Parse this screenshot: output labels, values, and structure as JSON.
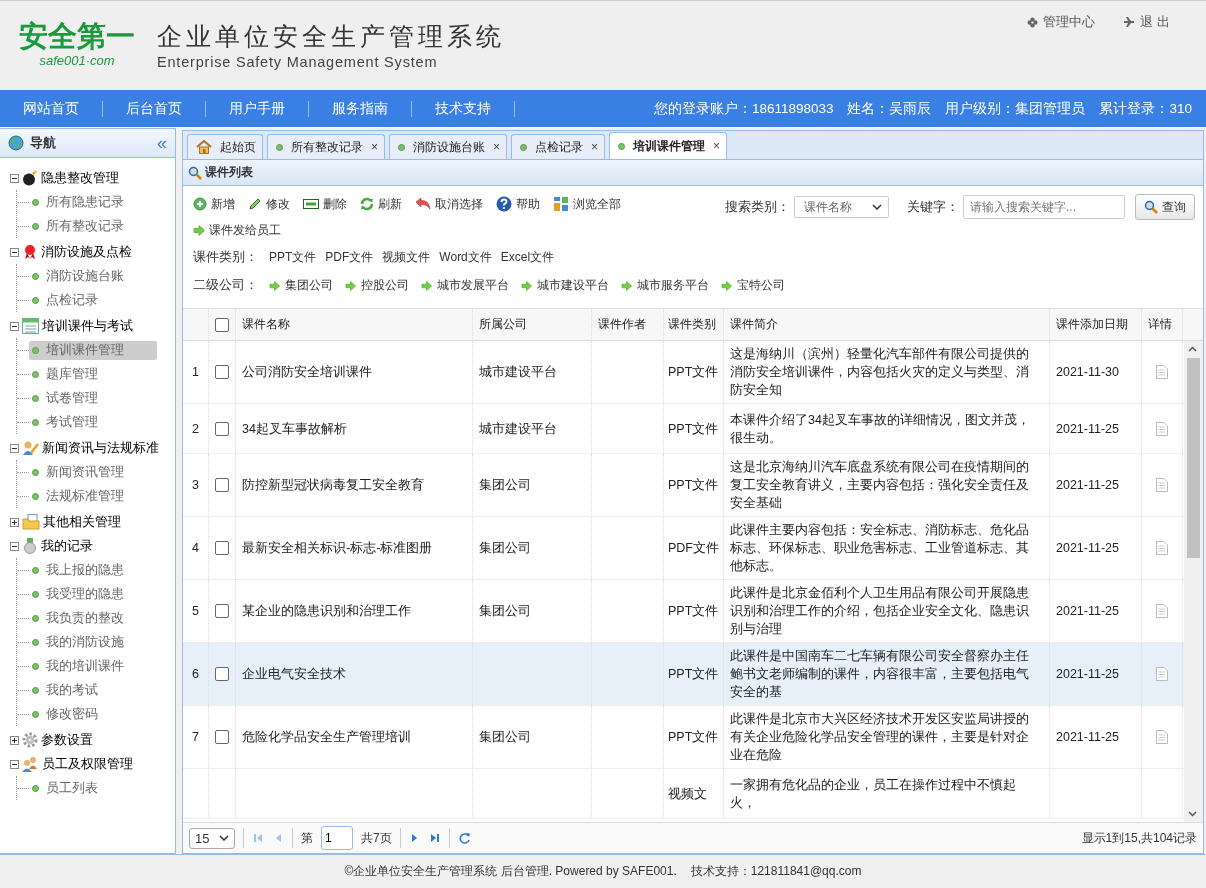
{
  "header": {
    "logo_text": "安全第一",
    "logo_url": "safe001·com",
    "title": "企业单位安全生产管理系统",
    "subtitle": "Enterprise Safety Management System",
    "links": [
      "管理中心",
      "退 出"
    ]
  },
  "nav": {
    "items": [
      "网站首页",
      "后台首页",
      "用户手册",
      "服务指南",
      "技术支持"
    ],
    "user_info": [
      "您的登录账户：18611898033",
      "姓名：吴雨辰",
      "用户级别：集团管理员",
      "累计登录：310"
    ]
  },
  "sidebar": {
    "title": "导航",
    "collapse": "«",
    "groups": [
      {
        "label": "隐患整改管理",
        "expanded": true,
        "children": [
          {
            "label": "所有隐患记录",
            "selected": false
          },
          {
            "label": "所有整改记录",
            "selected": false
          }
        ]
      },
      {
        "label": "消防设施及点检",
        "expanded": true,
        "children": [
          {
            "label": "消防设施台账",
            "selected": false
          },
          {
            "label": "点检记录",
            "selected": false
          }
        ]
      },
      {
        "label": "培训课件与考试",
        "expanded": true,
        "children": [
          {
            "label": "培训课件管理",
            "selected": true
          },
          {
            "label": "题库管理",
            "selected": false
          },
          {
            "label": "试卷管理",
            "selected": false
          },
          {
            "label": "考试管理",
            "selected": false
          }
        ]
      },
      {
        "label": "新闻资讯与法规标准",
        "expanded": true,
        "children": [
          {
            "label": "新闻资讯管理",
            "selected": false
          },
          {
            "label": "法规标准管理",
            "selected": false
          }
        ]
      },
      {
        "label": "其他相关管理",
        "expanded": false
      },
      {
        "label": "我的记录",
        "expanded": true,
        "children": [
          {
            "label": "我上报的隐患",
            "selected": false
          },
          {
            "label": "我受理的隐患",
            "selected": false
          },
          {
            "label": "我负责的整改",
            "selected": false
          },
          {
            "label": "我的消防设施",
            "selected": false
          },
          {
            "label": "我的培训课件",
            "selected": false
          },
          {
            "label": "我的考试",
            "selected": false
          },
          {
            "label": "修改密码",
            "selected": false
          }
        ]
      },
      {
        "label": "参数设置",
        "expanded": false
      },
      {
        "label": "员工及权限管理",
        "expanded": true,
        "children": [
          {
            "label": "员工列表",
            "selected": false
          }
        ]
      }
    ]
  },
  "tabs": [
    {
      "label": "起始页",
      "kind": "home",
      "selected": false
    },
    {
      "label": "所有整改记录",
      "kind": "page",
      "selected": false,
      "close": "×"
    },
    {
      "label": "消防设施台账",
      "kind": "page",
      "selected": false,
      "close": "×"
    },
    {
      "label": "点检记录",
      "kind": "page",
      "selected": false,
      "close": "×"
    },
    {
      "label": "培训课件管理",
      "kind": "page",
      "selected": true,
      "close": "×"
    }
  ],
  "panel": {
    "title": "课件列表",
    "toolbar": [
      "新增",
      "修改",
      "删除",
      "刷新",
      "取消选择",
      "帮助",
      "浏览全部",
      "课件发给员工"
    ],
    "search": {
      "category_label": "搜索类别：",
      "category_value": "课件名称",
      "keyword_label": "关键字：",
      "keyword_placeholder": "请输入搜索关键字...",
      "button": "查询"
    },
    "type_filter": {
      "label": "课件类别：",
      "options": [
        "PPT文件",
        "PDF文件",
        "视频文件",
        "Word文件",
        "Excel文件"
      ]
    },
    "company_filter": {
      "label": "二级公司：",
      "options": [
        "集团公司",
        "控股公司",
        "城市发展平台",
        "城市建设平台",
        "城市服务平台",
        "宝特公司"
      ]
    }
  },
  "table": {
    "select_all_checked": false,
    "columns": [
      "课件名称",
      "所属公司",
      "课件作者",
      "课件类别",
      "课件简介",
      "课件添加日期",
      "详情"
    ],
    "rows": [
      {
        "index": "1",
        "checked": false,
        "selected": false,
        "name": "公司消防安全培训课件",
        "company": "城市建设平台",
        "author": "",
        "category": "PPT文件",
        "intro": "这是海纳川（滨州）轻量化汽车部件有限公司提供的消防安全培训课件，内容包括火灾的定义与类型、消防安全知",
        "date": "2021-11-30"
      },
      {
        "index": "2",
        "checked": false,
        "selected": false,
        "name": "34起叉车事故解析",
        "company": "城市建设平台",
        "author": "",
        "category": "PPT文件",
        "intro": "本课件介绍了34起叉车事故的详细情况，图文并茂，很生动。",
        "date": "2021-11-25"
      },
      {
        "index": "3",
        "checked": false,
        "selected": false,
        "name": "防控新型冠状病毒复工安全教育",
        "company": "集团公司",
        "author": "",
        "category": "PPT文件",
        "intro": "这是北京海纳川汽车底盘系统有限公司在疫情期间的复工安全教育讲义，主要内容包括：强化安全责任及安全基础",
        "date": "2021-11-25"
      },
      {
        "index": "4",
        "checked": false,
        "selected": false,
        "name": "最新安全相关标识-标志-标准图册",
        "company": "集团公司",
        "author": "",
        "category": "PDF文件",
        "intro": "此课件主要内容包括：安全标志、消防标志、危化品标志、环保标志、职业危害标志、工业管道标志、其他标志。",
        "date": "2021-11-25"
      },
      {
        "index": "5",
        "checked": false,
        "selected": false,
        "name": "某企业的隐患识别和治理工作",
        "company": "集团公司",
        "author": "",
        "category": "PPT文件",
        "intro": "此课件是北京金佰利个人卫生用品有限公司开展隐患识别和治理工作的介绍，包括企业安全文化、隐患识别与治理",
        "date": "2021-11-25"
      },
      {
        "index": "6",
        "checked": false,
        "selected": true,
        "name": "企业电气安全技术",
        "company": "",
        "author": "",
        "category": "PPT文件",
        "intro": "此课件是中国南车二七车辆有限公司安全督察办主任鲍书文老师编制的课件，内容很丰富，主要包括电气安全的基",
        "date": "2021-11-25"
      },
      {
        "index": "7",
        "checked": false,
        "selected": false,
        "name": "危险化学品安全生产管理培训",
        "company": "集团公司",
        "author": "",
        "category": "PPT文件",
        "intro": "此课件是北京市大兴区经济技术开发区安监局讲授的有关企业危险化学品安全管理的课件，主要是针对企业在危险",
        "date": "2021-11-25"
      },
      {
        "index": "",
        "selected": false,
        "name": "",
        "company": "",
        "author": "",
        "category": "视频文",
        "intro": "一家拥有危化品的企业，员工在操作过程中不慎起火，",
        "date": ""
      }
    ]
  },
  "pager": {
    "page_size": "15",
    "page_prefix": "第",
    "page": "1",
    "page_total": "共7页",
    "summary": "显示1到15,共104记录"
  },
  "footer": {
    "copyright": "©企业单位安全生产管理系统 后台管理. Powered by SAFE001.",
    "support": "技术支持：121811841@qq.com"
  }
}
